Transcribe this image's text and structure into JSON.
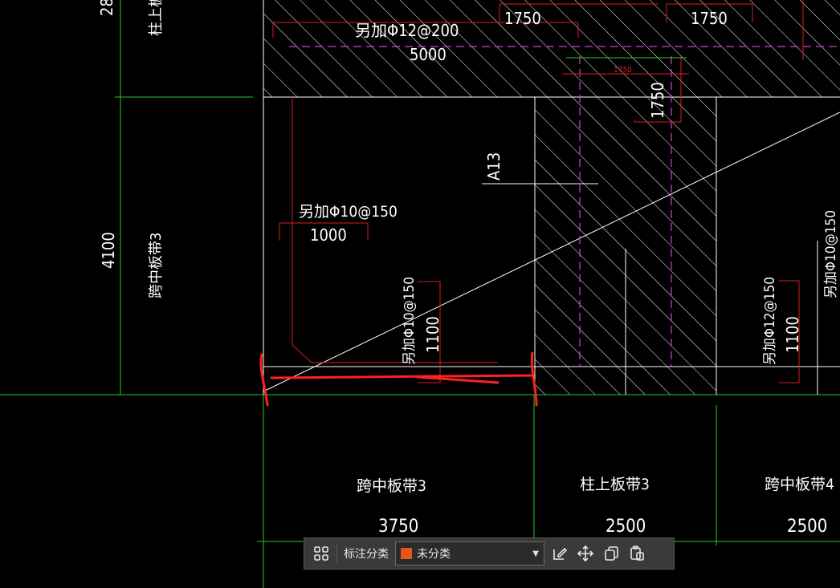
{
  "drawing": {
    "dims": {
      "top_left": "28",
      "left_4100": "4100",
      "top_5000": "5000",
      "top_1750a": "1750",
      "top_1750b": "1750",
      "small_1750": "1750",
      "vert_1750": "1750",
      "rebar_top": "另加Φ12@200",
      "rebar_mid": "另加Φ10@150",
      "rebar_mid_len": "1000",
      "rebar_v1": "另加Φ10@150",
      "rebar_v1_len": "1100",
      "rebar_v2": "另加Φ12@150",
      "rebar_v2_len": "1100",
      "rebar_right": "另加Φ10@150",
      "a13": "A13",
      "strip_top_left": "柱上板带",
      "strip_left_mid": "跨中板带3",
      "bottom_label1": "跨中板带3",
      "bottom_val1": "3750",
      "bottom_label2": "柱上板带3",
      "bottom_val2": "2500",
      "bottom_label3": "跨中板带4",
      "bottom_val3": "2500"
    },
    "colors": {
      "grid_green": "#22cc22",
      "hatch_white": "#ffffff",
      "dim_red": "#d42020",
      "magenta": "#cc44cc",
      "markup_red": "#ff2020"
    }
  },
  "toolbar": {
    "category_label": "标注分类",
    "selected_category": "未分类",
    "swatch_color": "#e8541e",
    "icons": [
      "layout-icon",
      "edit-icon",
      "move-icon",
      "copy-icon",
      "paste-icon"
    ]
  }
}
